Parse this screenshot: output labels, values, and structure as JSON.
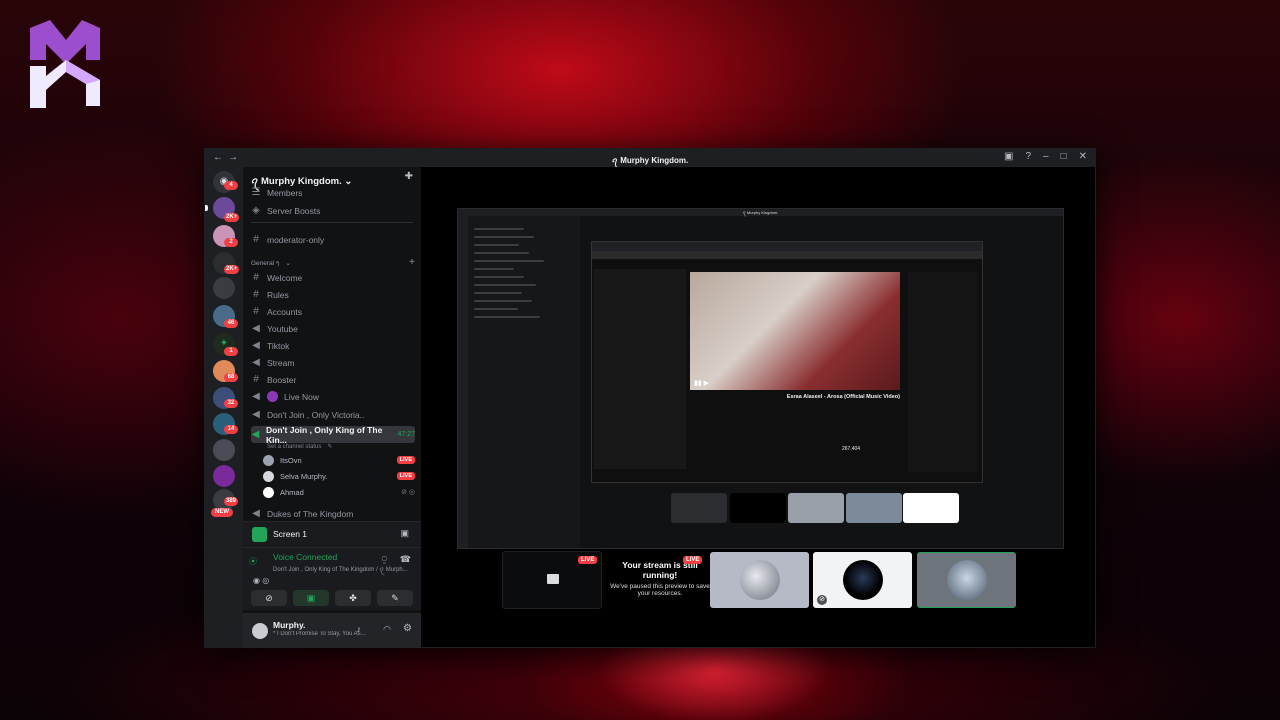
{
  "app": {
    "title": "ꪖ Murphy Kingdom.",
    "server_name": "ꪖ Murphy Kingdom.",
    "colors": {
      "accent": "#5865f2",
      "green": "#23a559",
      "red": "#f23f43"
    }
  },
  "guild_badges": [
    "4",
    "2K+",
    "2",
    "2K+",
    "46",
    "1",
    "68",
    "32",
    "14",
    "389",
    "NEW"
  ],
  "nav": {
    "members": "Members",
    "boosts": "Server Boosts",
    "moderator": "moderator-only",
    "category": "General ๆ",
    "channels": [
      "Welcome",
      "Rules",
      "Accounts",
      "Youtube",
      "Tiktok",
      "Stream",
      "Booster"
    ]
  },
  "voice": {
    "live_now": "Live Now",
    "dont_join_victoria": "Don't Join , Only Victoria..",
    "active_channel": "Don't Join , Only King of The Kin...",
    "active_time": "47:27",
    "status_hint": "Set a channel status",
    "users": [
      "ItsOvn",
      "Selva Murphy.",
      "Ahmad"
    ],
    "live_badge": "LIVE",
    "dukes": "Dukes of The Kingdom"
  },
  "panel": {
    "screen": "Screen 1",
    "voice_connected": "Voice Connected",
    "voice_path": "Don't Join , Only King of The Kingdom / ꪖ Murph...",
    "username": "Murphy.",
    "user_status": "* I Don't Promise To Stay, You As..."
  },
  "stage": {
    "paused_title": "Your stream is still running!",
    "paused_body": "We've paused this preview to save your resources.",
    "live": "LIVE"
  },
  "inner": {
    "title": "ꪖ Murphy Kingdom.",
    "yt_video_title": "Esraa Alaseel - Arosa (Official Music Video)",
    "yt_views": "267,404"
  }
}
